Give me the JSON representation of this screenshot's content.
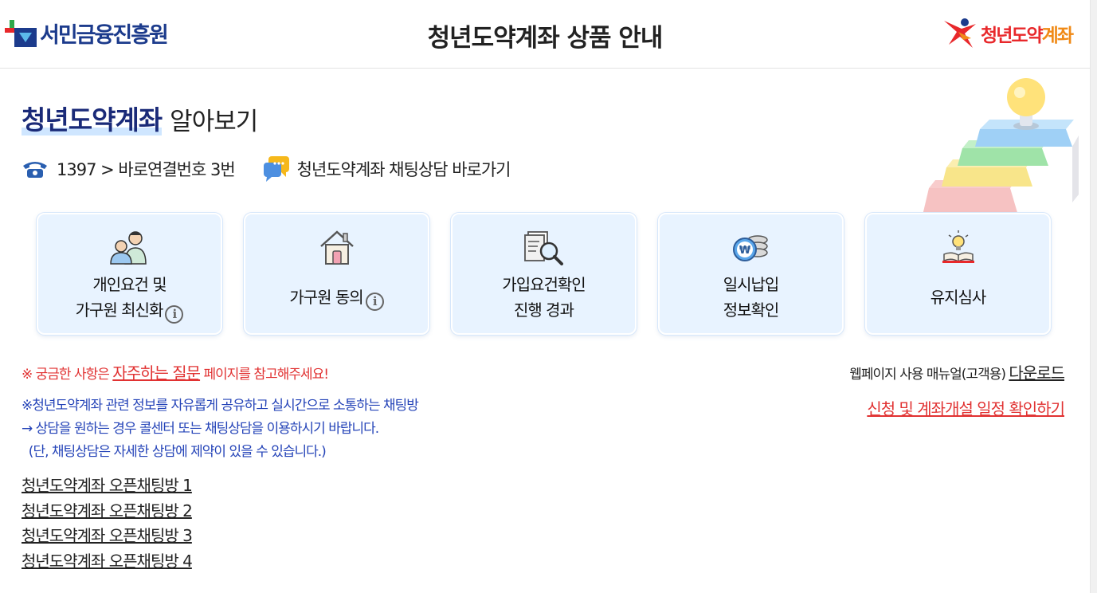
{
  "header": {
    "org_name": "서민금융진흥원",
    "title": "청년도약계좌 상품 안내",
    "brand_name_red": "청년도약",
    "brand_name_orange": "계좌"
  },
  "page_title": {
    "main": "청년도약계좌",
    "sub": "알아보기"
  },
  "contact": {
    "phone_icon": "phone-icon",
    "phone_text": "1397 > 바로연결번호 3번",
    "chat_icon": "chat-bubble-icon",
    "chat_text": "청년도약계좌 채팅상담 바로가기"
  },
  "cards": [
    {
      "icon": "people-icon",
      "line1": "개인요건 및",
      "line2": "가구원 최신화",
      "info": "i"
    },
    {
      "icon": "house-icon",
      "line1": "가구원 동의",
      "info": "i"
    },
    {
      "icon": "document-search-icon",
      "line1": "가입요건확인",
      "line2": "진행 경과"
    },
    {
      "icon": "won-coins-icon",
      "line1": "일시납입",
      "line2": "정보확인"
    },
    {
      "icon": "lightbulb-book-icon",
      "line1": "유지심사"
    }
  ],
  "notice": {
    "prefix": "※ 궁금한 사항은 ",
    "faq_link": "자주하는 질문",
    "suffix": " 페이지를 참고해주세요!"
  },
  "manual": {
    "label": "웹페이지 사용 매뉴얼(고객용) ",
    "download_link": "다운로드"
  },
  "schedule_link": "신청 및 계좌개설 일정 확인하기",
  "blue_notes": [
    "※청년도약계좌 관련 정보를 자유롭게 공유하고 실시간으로 소통하는 채팅방",
    "→ 상담을 원하는 경우 콜센터 또는 채팅상담을 이용하시기 바랍니다.",
    "  (단, 채팅상담은 자세한 상담에 제약이 있을 수 있습니다.)"
  ],
  "chat_rooms": [
    "청년도약계좌 오픈채팅방 1",
    "청년도약계좌 오픈채팅방 2",
    "청년도약계좌 오픈채팅방 3",
    "청년도약계좌 오픈채팅방 4"
  ],
  "colors": {
    "navy": "#1a2a78",
    "red": "#e13232",
    "blue_text": "#2544b8",
    "card_bg": "#e8f3ff",
    "brand_orange": "#f08a17"
  }
}
